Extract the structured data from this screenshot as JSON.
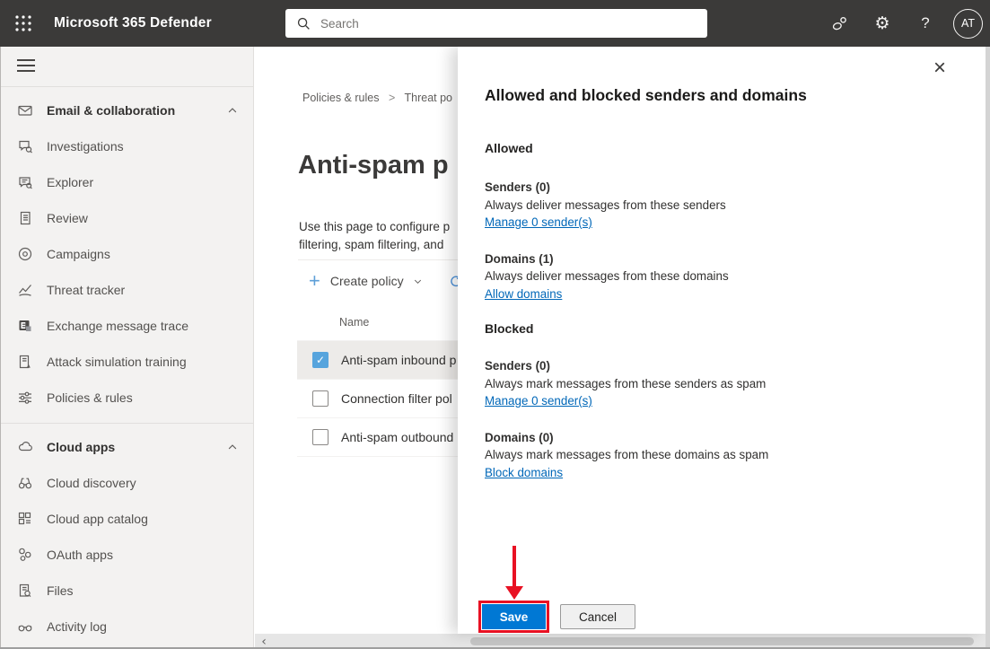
{
  "topbar": {
    "app_title": "Microsoft 365 Defender",
    "search_placeholder": "Search",
    "avatar_initials": "AT",
    "icons": [
      "waffle-icon",
      "search-icon",
      "feedback-icon",
      "gear-icon",
      "help-icon"
    ]
  },
  "glyphs": {
    "plus": "+",
    "close": "×",
    "check": "✓",
    "help": "?",
    "gear": "⚙",
    "back": "‹",
    "breadcrumb_sep": ">"
  },
  "sidebar": {
    "sections": [
      {
        "label": "Email & collaboration",
        "icon": "mail-icon",
        "items": [
          {
            "label": "Investigations",
            "icon": "investigations-icon"
          },
          {
            "label": "Explorer",
            "icon": "explorer-icon"
          },
          {
            "label": "Review",
            "icon": "review-icon"
          },
          {
            "label": "Campaigns",
            "icon": "campaigns-icon"
          },
          {
            "label": "Threat tracker",
            "icon": "threat-tracker-icon"
          },
          {
            "label": "Exchange message trace",
            "icon": "exchange-icon"
          },
          {
            "label": "Attack simulation training",
            "icon": "attack-simulation-icon"
          },
          {
            "label": "Policies & rules",
            "icon": "policies-rules-icon"
          }
        ]
      },
      {
        "label": "Cloud apps",
        "icon": "cloud-icon",
        "items": [
          {
            "label": "Cloud discovery",
            "icon": "cloud-discovery-icon"
          },
          {
            "label": "Cloud app catalog",
            "icon": "cloud-app-catalog-icon"
          },
          {
            "label": "OAuth apps",
            "icon": "oauth-apps-icon"
          },
          {
            "label": "Files",
            "icon": "files-icon"
          },
          {
            "label": "Activity log",
            "icon": "activity-log-icon"
          }
        ]
      }
    ]
  },
  "main": {
    "breadcrumb": {
      "first": "Policies & rules",
      "second": "Threat po"
    },
    "page_title": "Anti-spam p",
    "description_line1": "Use this page to configure p",
    "description_line2": "filtering, spam filtering, and",
    "toolbar": {
      "create_policy": "Create policy"
    },
    "table": {
      "header": "Name",
      "rows": [
        {
          "name": "Anti-spam inbound p",
          "checked": true,
          "selected": true
        },
        {
          "name": "Connection filter pol",
          "checked": false,
          "selected": false
        },
        {
          "name": "Anti-spam outbound",
          "checked": false,
          "selected": false
        }
      ]
    }
  },
  "flyout": {
    "title": "Allowed and blocked senders and domains",
    "sections": [
      {
        "heading": "Allowed",
        "groups": [
          {
            "label": "Senders (0)",
            "desc": "Always deliver messages from these senders",
            "link": "Manage 0 sender(s)"
          },
          {
            "label": "Domains (1)",
            "desc": "Always deliver messages from these domains",
            "link": "Allow domains"
          }
        ]
      },
      {
        "heading": "Blocked",
        "groups": [
          {
            "label": "Senders (0)",
            "desc": "Always mark messages from these senders as spam",
            "link": "Manage 0 sender(s)"
          },
          {
            "label": "Domains (0)",
            "desc": "Always mark messages from these domains as spam",
            "link": "Block domains"
          }
        ]
      }
    ],
    "save_label": "Save",
    "cancel_label": "Cancel"
  },
  "colors": {
    "accent": "#0078d4",
    "annotation_red": "#e81123",
    "link_blue": "#0067b8",
    "topbar_bg": "#3b3a39",
    "sidebar_bg": "#f3f2f1",
    "selected_row_bg": "#edebe9",
    "checkbox_checked": "#57a4dd"
  }
}
